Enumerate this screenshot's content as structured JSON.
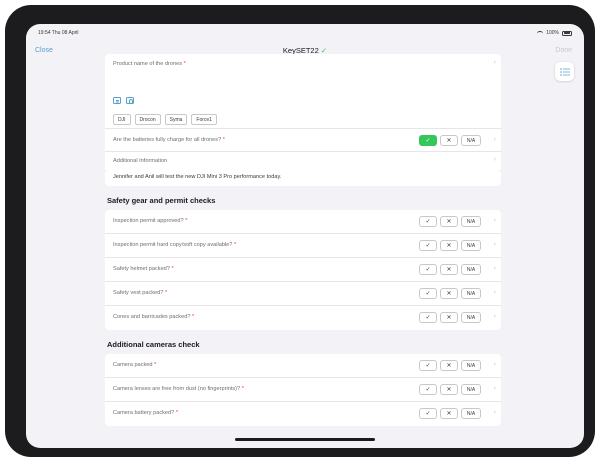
{
  "status": {
    "time": "19:54 Thu 08 April",
    "battery": "100%"
  },
  "nav": {
    "close_label": "Close",
    "title": "KeySET22",
    "title_check": "✓",
    "done_label": "Done"
  },
  "top_card": {
    "product_label": "Product name of the drones",
    "chips": [
      "DJI",
      "Drocon",
      "Syma",
      "Force1"
    ],
    "battery_question": "Are the batteries fully charge for all drones?",
    "info_label": "Additional Information",
    "info_text": "Jennifer and Anil will test the new DJI Mini 3 Pro performance today."
  },
  "answers": {
    "yes": "✓",
    "no": "✕",
    "na": "N/A"
  },
  "sections": [
    {
      "title": "Safety gear and permit checks",
      "items": [
        "Inspection permit approved?",
        "Inspection permit hard copy/soft copy available?",
        "Safety helmet packed?",
        "Safety vest packed?",
        "Cones and barricades packed?"
      ]
    },
    {
      "title": "Additional cameras check",
      "items": [
        "Camera packed",
        "Camera lenses are free from dust (no fingerprints)?",
        "Camera battery packed?"
      ]
    }
  ],
  "colors": {
    "accent": "#5aa0cc",
    "selected_yes": "#34c759",
    "required": "#ff3b30"
  }
}
